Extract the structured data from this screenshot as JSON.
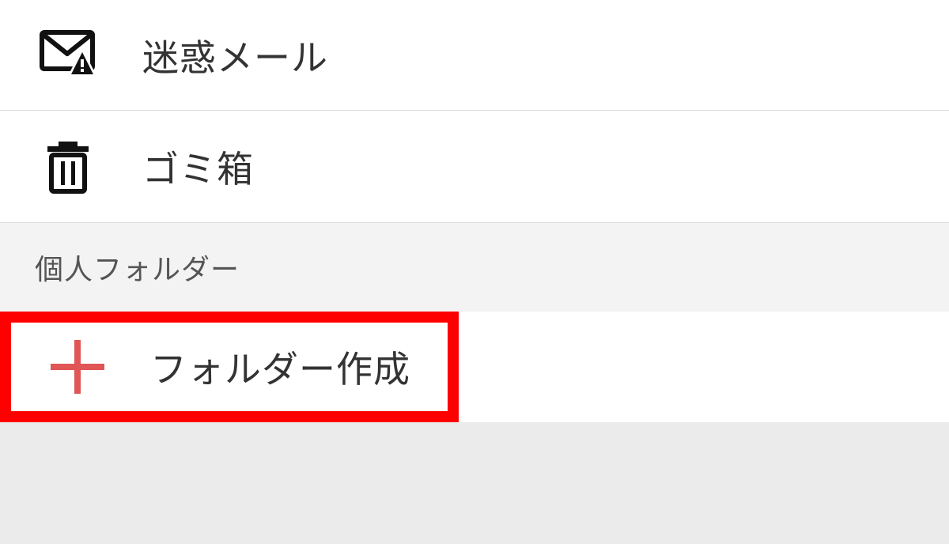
{
  "folders": [
    {
      "label": "迷惑メール",
      "icon": "spam-mail-icon"
    },
    {
      "label": "ゴミ箱",
      "icon": "trash-icon"
    }
  ],
  "section": {
    "title": "個人フォルダー"
  },
  "create_folder": {
    "label": "フォルダー作成",
    "icon": "plus-icon",
    "icon_color": "#e05555",
    "highlight_color": "#ff0000"
  }
}
